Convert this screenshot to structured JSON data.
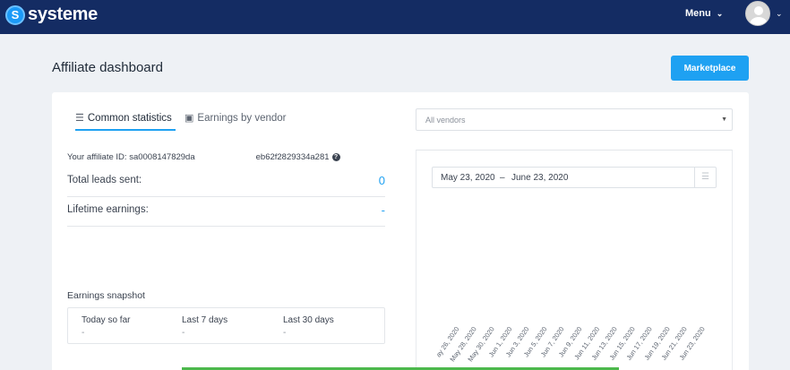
{
  "header": {
    "logo_text": "systeme",
    "menu_label": "Menu"
  },
  "page": {
    "title": "Affiliate dashboard",
    "marketplace_label": "Marketplace"
  },
  "tabs": [
    {
      "label": "Common statistics",
      "icon": "list-icon",
      "active": true
    },
    {
      "label": "Earnings by vendor",
      "icon": "money-icon",
      "active": false
    }
  ],
  "stats": {
    "affiliate_id_label": "Your affiliate ID:",
    "affiliate_id_start": "sa0008147829da",
    "affiliate_id_end": "eb62f2829334a281",
    "leads_label": "Total leads sent:",
    "leads_value": "0",
    "earnings_label": "Lifetime earnings:",
    "earnings_value": "-"
  },
  "snapshot": {
    "title": "Earnings snapshot",
    "today_label": "Today so far",
    "today_value": "-",
    "last7_label": "Last 7 days",
    "last7_value": "-",
    "last30_label": "Last 30 days",
    "last30_value": "-"
  },
  "vendor_filter": {
    "placeholder": "All vendors"
  },
  "date_range": {
    "start": "May 23, 2020",
    "separator": "–",
    "end": "June 23, 2020"
  },
  "x_ticks": [
    "ay 26, 2020",
    "May 28, 2020",
    "May 30, 2020",
    "Jun 1, 2020",
    "Jun 3, 2020",
    "Jun 5, 2020",
    "Jun 7, 2020",
    "Jun 9, 2020",
    "Jun 11, 2020",
    "Jun 13, 2020",
    "Jun 15, 2020",
    "Jun 17, 2020",
    "Jun 19, 2020",
    "Jun 21, 2020",
    "Jun 23, 2020"
  ],
  "colors": {
    "topbar": "#142c63",
    "accent": "#1ea1f2",
    "progress": "#4cb84c"
  }
}
